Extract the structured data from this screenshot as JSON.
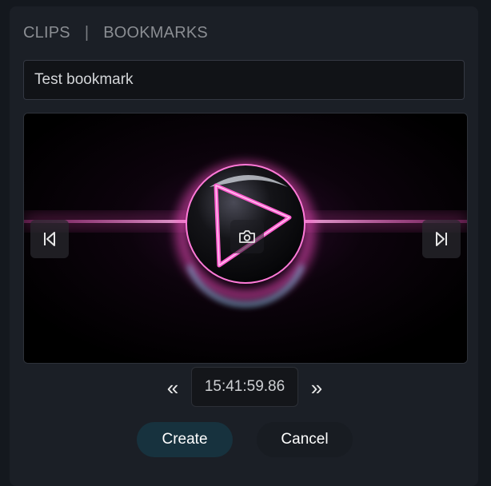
{
  "tabs": {
    "clips": "CLIPS",
    "separator": "|",
    "bookmarks": "BOOKMARKS"
  },
  "bookmark": {
    "name_value": "Test bookmark"
  },
  "preview": {
    "prev_icon": "skip-back-icon",
    "next_icon": "skip-forward-icon",
    "snapshot_icon": "camera-icon",
    "accent": "#ff4fc8",
    "glow": "#7fe3ff"
  },
  "time": {
    "back_glyph": "«",
    "forward_glyph": "»",
    "value": "15:41:59.86"
  },
  "actions": {
    "create_label": "Create",
    "cancel_label": "Cancel"
  }
}
